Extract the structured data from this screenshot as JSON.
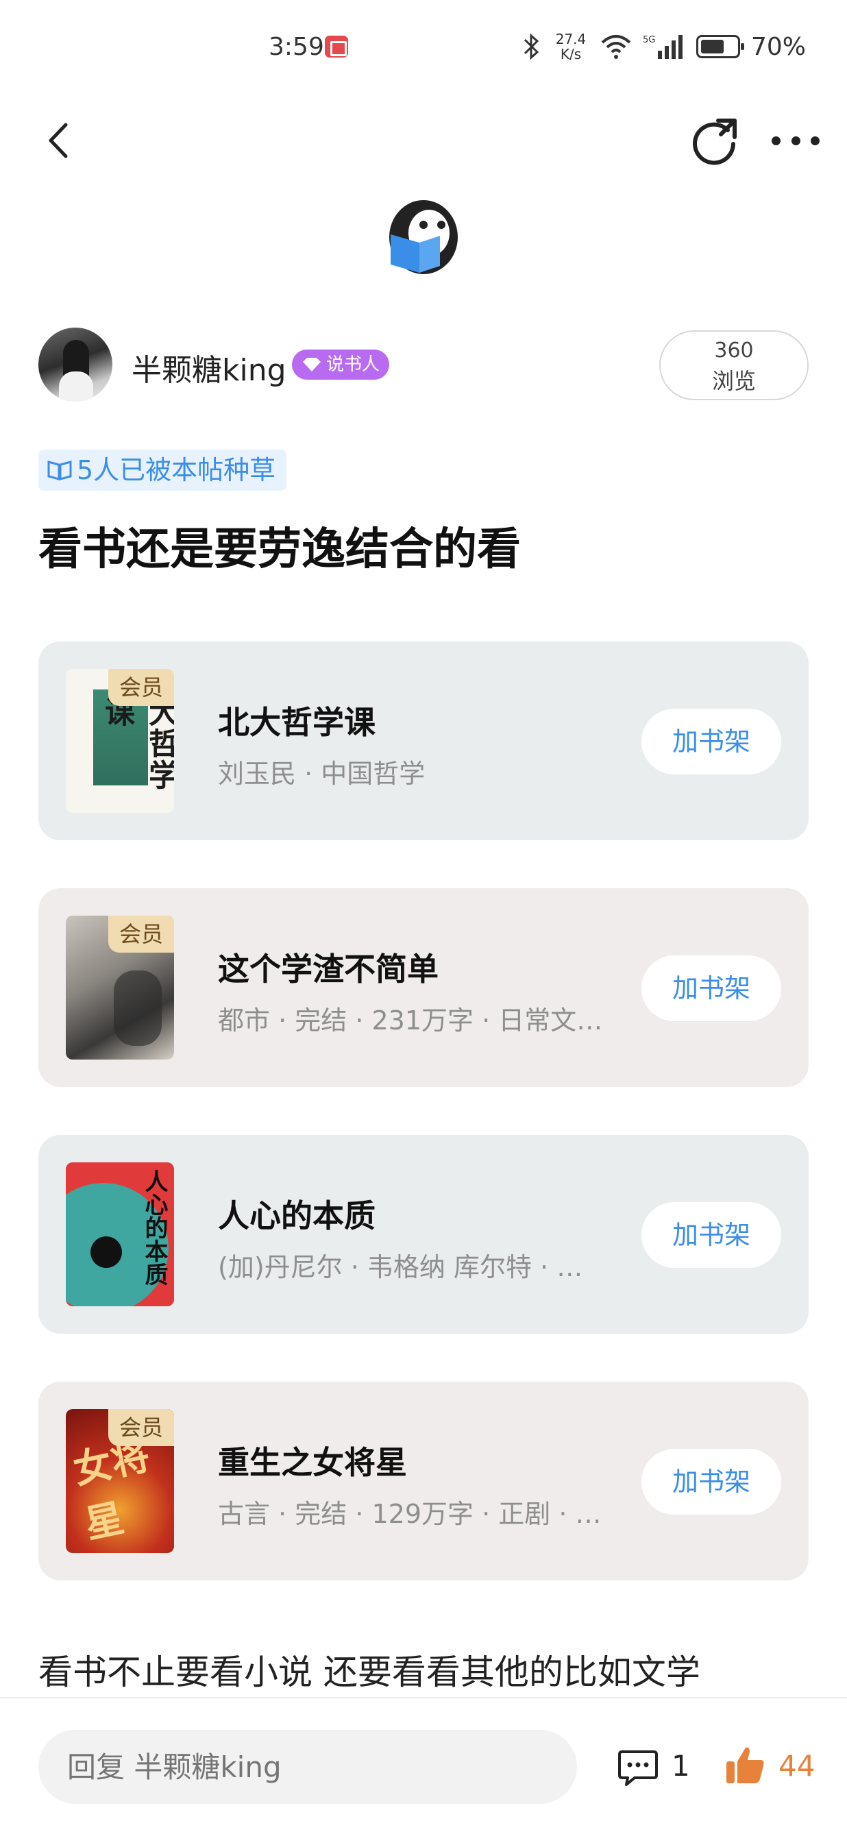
{
  "status_bar": {
    "time": "3:59",
    "net_speed_value": "27.4",
    "net_speed_unit": "K/s",
    "battery": "70%",
    "battery_level": 0.7
  },
  "header": {
    "back_icon": "chevron-left-icon",
    "refresh_icon": "refresh-icon",
    "more_icon": "more-dots-icon"
  },
  "author": {
    "name": "半颗糖king",
    "badge": "说书人",
    "views_count": "360",
    "views_label": "浏览"
  },
  "post": {
    "recommend_tag": "5人已被本帖种草",
    "title": "看书还是要劳逸结合的看",
    "body_text": "看书不止要看小说 还要看看其他的比如文学"
  },
  "books": [
    {
      "title": "北大哲学课",
      "meta": "刘玉民 · 中国哲学",
      "vip": "会员",
      "cover_text": "大哲学课",
      "action": "加书架"
    },
    {
      "title": "这个学渣不简单",
      "meta": "都市 · 完结 · 231万字 · 日常文…",
      "vip": "会员",
      "cover_text": "",
      "action": "加书架"
    },
    {
      "title": "人心的本质",
      "meta": "(加)丹尼尔 · 韦格纳 库尔特 · …",
      "vip": "",
      "cover_text": "人心的本质",
      "action": "加书架"
    },
    {
      "title": "重生之女将星",
      "meta": "古言 · 完结 · 129万字 · 正剧 · …",
      "vip": "会员",
      "cover_text": "女将星",
      "action": "加书架"
    }
  ],
  "bottom_bar": {
    "reply_placeholder": "回复 半颗糖king",
    "comment_count": "1",
    "like_count": "44"
  },
  "colors": {
    "accent_blue": "#3b8ee8",
    "badge_purple": "#b86af0",
    "vip_gold": "#f0dcb0",
    "like_orange": "#e8823a"
  }
}
